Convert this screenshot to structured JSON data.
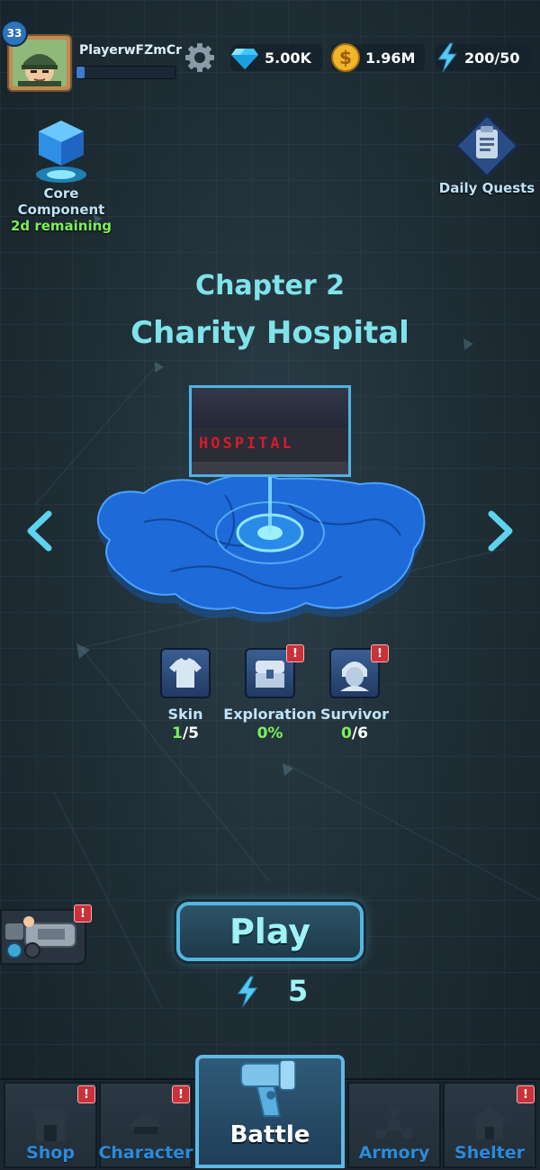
{
  "player": {
    "level": "33",
    "name": "PlayerwFZmCr",
    "xp_fraction": 0.08
  },
  "resources": {
    "gems": "5.00K",
    "coins": "1.96M",
    "energy": "200/50"
  },
  "core_component": {
    "label": "Core Component",
    "remaining": "2d remaining"
  },
  "daily_quests": {
    "label": "Daily Quests"
  },
  "chapter": {
    "number": "Chapter 2",
    "name": "Charity Hospital",
    "sign_text": "HOSPITAL"
  },
  "stats": [
    {
      "label": "Skin",
      "value_hl": "1",
      "value_rest": "/5",
      "alert": false
    },
    {
      "label": "Exploration",
      "value_hl": "0%",
      "value_rest": "",
      "alert": true
    },
    {
      "label": "Survivor",
      "value_hl": "0",
      "value_rest": "/6",
      "alert": true
    }
  ],
  "play": {
    "label": "Play",
    "energy_cost": "5"
  },
  "alert_mark": "!",
  "nav": {
    "shop": "Shop",
    "character": "Character",
    "battle": "Battle",
    "armory": "Armory",
    "shelter": "Shelter"
  },
  "colors": {
    "accent_cyan": "#7fe3ea",
    "alert_red": "#c8323a",
    "highlight_green": "#7df05a",
    "nav_blue": "#2d8ad8"
  }
}
